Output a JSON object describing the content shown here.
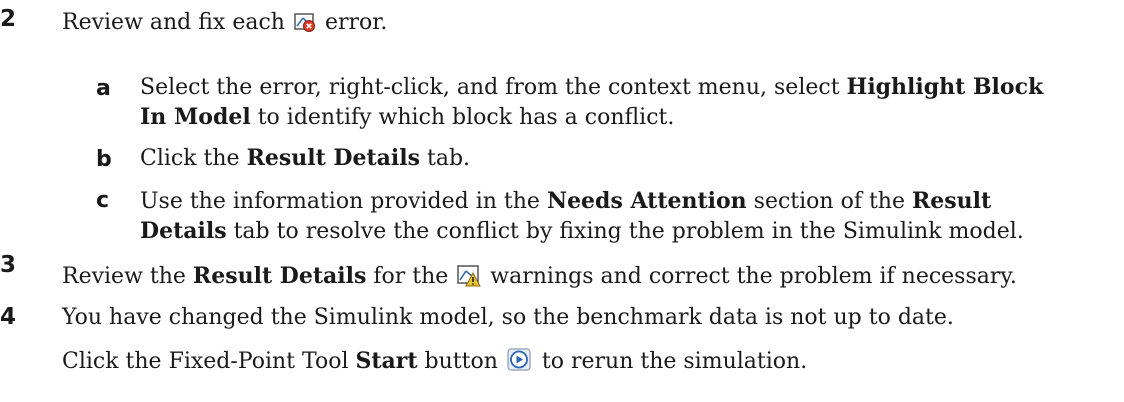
{
  "steps": [
    {
      "number": "2",
      "before_icon": "Review and fix each",
      "icon": "error-icon",
      "after_icon": "error.",
      "substeps": [
        {
          "letter": "a",
          "line1_pre": "Select the error, right-click, and from the context menu, select ",
          "line1_bold": "Highlight Block",
          "line2_bold": "In Model",
          "line2_post": " to identify which block has a conflict."
        },
        {
          "letter": "b",
          "pre": "Click the ",
          "bold": "Result Details",
          "post": " tab."
        },
        {
          "letter": "c",
          "line1_pre": "Use the information provided in the ",
          "line1_bold1": "Needs Attention",
          "line1_mid": " section of the ",
          "line1_bold2": "Result",
          "line2_bold": "Details",
          "line2_post": " tab to resolve the conflict by fixing the problem in the Simulink model."
        }
      ]
    },
    {
      "number": "3",
      "pre": "Review the ",
      "bold": "Result Details",
      "mid": " for the",
      "icon": "warning-icon",
      "post": "warnings and correct the problem if necessary."
    },
    {
      "number": "4",
      "line1": "You have changed the Simulink model, so the benchmark data is not up to date.",
      "line2_pre": "Click the Fixed-Point Tool ",
      "line2_bold": "Start",
      "line2_mid": " button",
      "icon": "start-button-icon",
      "line2_post": "to rerun the simulation."
    }
  ],
  "colors": {
    "error_red": "#d9402a",
    "warning_yellow": "#e8c43a",
    "play_blue": "#2a64b8"
  }
}
